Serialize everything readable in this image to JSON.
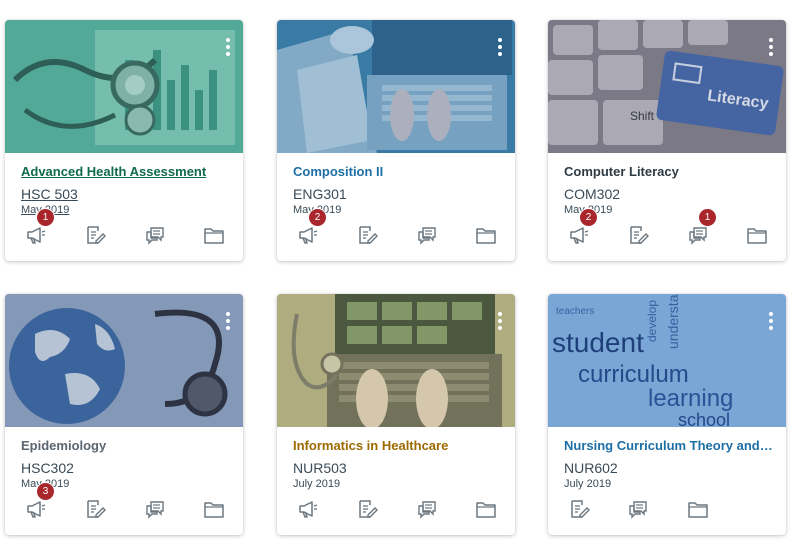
{
  "courses": [
    {
      "title": "Advanced Health Assessment",
      "code": "HSC 503",
      "term": "May 2019",
      "title_color": "#0F6B4B",
      "announcement_badge": "1",
      "discussion_badge": ""
    },
    {
      "title": "Composition II",
      "code": "ENG301",
      "term": "May 2019",
      "title_color": "#1D6FA5",
      "announcement_badge": "2",
      "discussion_badge": ""
    },
    {
      "title": "Computer Literacy",
      "code": "COM302",
      "term": "May 2019",
      "title_color": "#2D3B45",
      "announcement_badge": "2",
      "discussion_badge": "1"
    },
    {
      "title": "Epidemiology",
      "code": "HSC302",
      "term": "May 2019",
      "title_color": "#5B6670",
      "announcement_badge": "3",
      "discussion_badge": ""
    },
    {
      "title": "Informatics in Healthcare",
      "code": "NUR503",
      "term": "July 2019",
      "title_color": "#9C6A00",
      "announcement_badge": "",
      "discussion_badge": ""
    },
    {
      "title": "Nursing Curriculum Theory and D...",
      "code": "NUR602",
      "term": "July 2019",
      "title_color": "#1D6FA5",
      "announcement_badge": "",
      "discussion_badge": ""
    }
  ],
  "hero_words": {
    "literacy_key": "Literacy",
    "shift_key": "Shift",
    "word_cloud": [
      "student",
      "curriculum",
      "learning",
      "school",
      "understand",
      "develop",
      "teachers"
    ]
  },
  "icons": {
    "announcements": "megaphone-icon",
    "assignments": "assignment-edit-icon",
    "discussions": "discussion-icon",
    "files": "folder-icon",
    "menu": "kebab-menu-icon"
  },
  "colors": {
    "badge": "#A8262C",
    "icon": "#6B7780",
    "overlay_teal": "#2E9C86",
    "overlay_blue": "#2A6E9E",
    "overlay_slate": "#6D7A8C",
    "overlay_olive": "#8C8A50"
  }
}
